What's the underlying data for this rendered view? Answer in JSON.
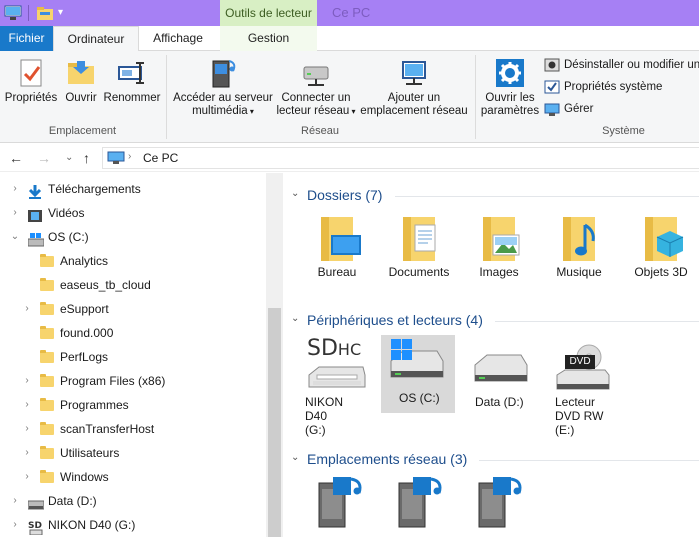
{
  "window": {
    "context_group": "Outils de lecteur",
    "title": "Ce PC"
  },
  "tabs": [
    "Fichier",
    "Ordinateur",
    "Affichage",
    "Gestion"
  ],
  "ribbon": {
    "emplacement": {
      "label": "Emplacement",
      "buttons": [
        "Propriétés",
        "Ouvrir",
        "Renommer"
      ]
    },
    "reseau": {
      "label": "Réseau",
      "media": [
        "Accéder au serveur",
        "multimédia"
      ],
      "connect": [
        "Connecter un",
        "lecteur réseau"
      ],
      "add": [
        "Ajouter un",
        "emplacement réseau"
      ]
    },
    "systeme": {
      "label": "Système",
      "settings": [
        "Ouvrir les",
        "paramètres"
      ],
      "uninstall": "Désinstaller ou modifier un",
      "props": "Propriétés système",
      "manage": "Gérer"
    }
  },
  "address": {
    "path": "Ce PC"
  },
  "nav": [
    {
      "label": "Téléchargements",
      "icon": "download-icon",
      "chev": "›"
    },
    {
      "label": "Vidéos",
      "icon": "video-icon",
      "chev": "›"
    },
    {
      "label": "OS (C:)",
      "icon": "os-drive-icon",
      "chev": "⌄"
    },
    {
      "label": "Analytics",
      "icon": "folder-icon",
      "chev": ""
    },
    {
      "label": "easeus_tb_cloud",
      "icon": "folder-icon",
      "chev": ""
    },
    {
      "label": "eSupport",
      "icon": "folder-icon",
      "chev": "›"
    },
    {
      "label": "found.000",
      "icon": "folder-icon",
      "chev": ""
    },
    {
      "label": "PerfLogs",
      "icon": "folder-icon",
      "chev": ""
    },
    {
      "label": "Program Files (x86)",
      "icon": "folder-icon",
      "chev": "›"
    },
    {
      "label": "Programmes",
      "icon": "folder-icon",
      "chev": "›"
    },
    {
      "label": "scanTransferHost",
      "icon": "folder-icon",
      "chev": "›"
    },
    {
      "label": "Utilisateurs",
      "icon": "folder-icon",
      "chev": "›"
    },
    {
      "label": "Windows",
      "icon": "folder-icon",
      "chev": "›"
    },
    {
      "label": "Data (D:)",
      "icon": "drive-icon",
      "chev": "›"
    },
    {
      "label": "NIKON D40 (G:)",
      "icon": "sd-card-icon",
      "chev": "›"
    }
  ],
  "sections": {
    "dossiers": {
      "title": "Dossiers (7)",
      "items": [
        "Bureau",
        "Documents",
        "Images",
        "Musique",
        "Objets 3D"
      ]
    },
    "peripheriques": {
      "title": "Périphériques et lecteurs (4)",
      "items": [
        [
          "NIKON D40",
          "(G:)",
          ""
        ],
        [
          "OS (C:)",
          "",
          ""
        ],
        [
          "Data (D:)",
          "",
          ""
        ],
        [
          "Lecteur",
          "DVD RW",
          "(E:)"
        ]
      ],
      "sd_badge": "SD",
      "sd_badge2": "HC",
      "dvd_badge": "DVD"
    },
    "reseau": {
      "title": "Emplacements réseau (3)"
    }
  },
  "colors": {
    "titlebar": "#a680f4",
    "accent": "#1979ca",
    "folder": "#f7d46d",
    "section_title": "#1e4e8c"
  }
}
